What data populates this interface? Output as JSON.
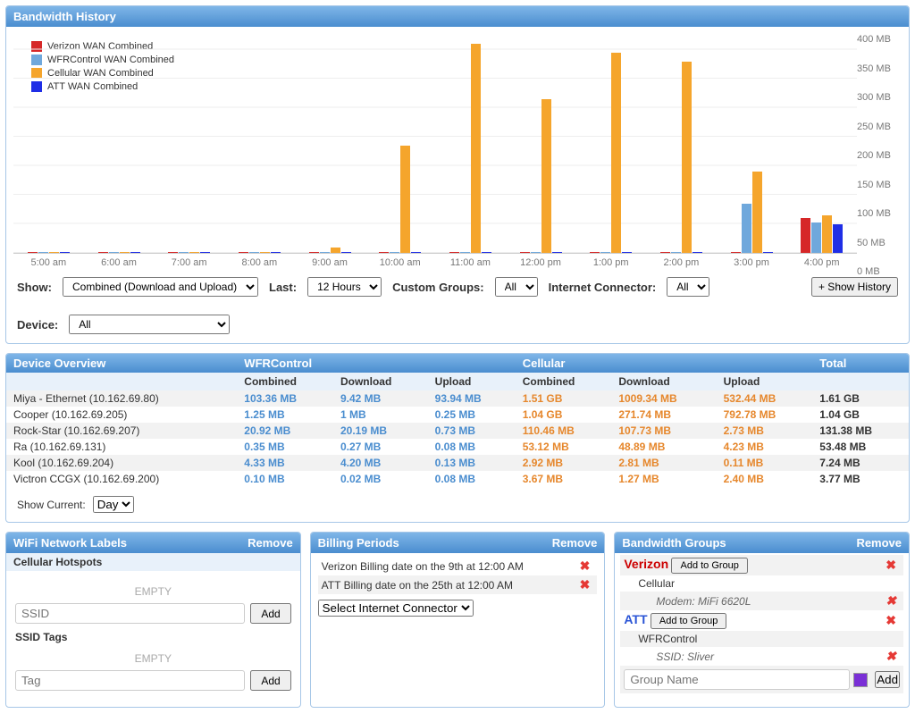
{
  "bandwidth_history": {
    "title": "Bandwidth History",
    "legend": [
      {
        "label": "Verizon WAN Combined",
        "color": "#d62728"
      },
      {
        "label": "WFRControl WAN Combined",
        "color": "#6fa8dc"
      },
      {
        "label": "Cellular WAN Combined",
        "color": "#f5a52c"
      },
      {
        "label": "ATT WAN Combined",
        "color": "#1f2ee6"
      }
    ],
    "controls": {
      "show_label": "Show:",
      "show_value": "Combined (Download and Upload)",
      "last_label": "Last:",
      "last_value": "12 Hours",
      "groups_label": "Custom Groups:",
      "groups_value": "All",
      "connector_label": "Internet Connector:",
      "connector_value": "All",
      "device_label": "Device:",
      "device_value": "All",
      "show_history": "+ Show History"
    }
  },
  "chart_data": {
    "type": "bar",
    "title": "Bandwidth History",
    "ylabel": "MB",
    "ylim": [
      0,
      400
    ],
    "categories": [
      "5:00 am",
      "6:00 am",
      "7:00 am",
      "8:00 am",
      "9:00 am",
      "10:00 am",
      "11:00 am",
      "12:00 pm",
      "1:00 pm",
      "2:00 pm",
      "3:00 pm",
      "4:00 pm"
    ],
    "y_ticks": [
      "400 MB",
      "350 MB",
      "300 MB",
      "250 MB",
      "200 MB",
      "150 MB",
      "100 MB",
      "50 MB",
      "0 MB"
    ],
    "series": [
      {
        "name": "Verizon WAN Combined",
        "color": "#d62728",
        "values": [
          0,
          0,
          0,
          0,
          0,
          0,
          0,
          0,
          0,
          0,
          0,
          60
        ]
      },
      {
        "name": "WFRControl WAN Combined",
        "color": "#6fa8dc",
        "values": [
          0,
          0,
          0,
          0,
          0,
          0,
          0,
          0,
          0,
          0,
          85,
          52
        ]
      },
      {
        "name": "Cellular WAN Combined",
        "color": "#f5a52c",
        "values": [
          2,
          2,
          1,
          2,
          10,
          185,
          360,
          265,
          345,
          330,
          140,
          65
        ]
      },
      {
        "name": "ATT WAN Combined",
        "color": "#1f2ee6",
        "values": [
          0,
          0,
          0,
          0,
          0,
          0,
          0,
          0,
          0,
          0,
          0,
          50
        ]
      }
    ]
  },
  "device_overview": {
    "title": "Device Overview",
    "group_wfr": "WFRControl",
    "group_cell": "Cellular",
    "group_total": "Total",
    "col_combined": "Combined",
    "col_download": "Download",
    "col_upload": "Upload",
    "rows": [
      {
        "name": "Miya - Ethernet (10.162.69.80)",
        "wfr_c": "103.36 MB",
        "wfr_d": "9.42 MB",
        "wfr_u": "93.94 MB",
        "cel_c": "1.51 GB",
        "cel_d": "1009.34 MB",
        "cel_u": "532.44 MB",
        "total": "1.61 GB"
      },
      {
        "name": "Cooper (10.162.69.205)",
        "wfr_c": "1.25 MB",
        "wfr_d": "1 MB",
        "wfr_u": "0.25 MB",
        "cel_c": "1.04 GB",
        "cel_d": "271.74 MB",
        "cel_u": "792.78 MB",
        "total": "1.04 GB"
      },
      {
        "name": "Rock-Star (10.162.69.207)",
        "wfr_c": "20.92 MB",
        "wfr_d": "20.19 MB",
        "wfr_u": "0.73 MB",
        "cel_c": "110.46 MB",
        "cel_d": "107.73 MB",
        "cel_u": "2.73 MB",
        "total": "131.38 MB"
      },
      {
        "name": "Ra (10.162.69.131)",
        "wfr_c": "0.35 MB",
        "wfr_d": "0.27 MB",
        "wfr_u": "0.08 MB",
        "cel_c": "53.12 MB",
        "cel_d": "48.89 MB",
        "cel_u": "4.23 MB",
        "total": "53.48 MB"
      },
      {
        "name": "Kool (10.162.69.204)",
        "wfr_c": "4.33 MB",
        "wfr_d": "4.20 MB",
        "wfr_u": "0.13 MB",
        "cel_c": "2.92 MB",
        "cel_d": "2.81 MB",
        "cel_u": "0.11 MB",
        "total": "7.24 MB"
      },
      {
        "name": "Victron CCGX (10.162.69.200)",
        "wfr_c": "0.10 MB",
        "wfr_d": "0.02 MB",
        "wfr_u": "0.08 MB",
        "cel_c": "3.67 MB",
        "cel_d": "1.27 MB",
        "cel_u": "2.40 MB",
        "total": "3.77 MB"
      }
    ],
    "show_current_label": "Show Current:",
    "show_current_value": "Day"
  },
  "wifi_labels": {
    "title": "WiFi Network Labels",
    "remove": "Remove",
    "hotspots_label": "Cellular Hotspots",
    "empty": "EMPTY",
    "ssid_placeholder": "SSID",
    "tags_label": "SSID Tags",
    "tag_placeholder": "Tag",
    "add": "Add"
  },
  "billing": {
    "title": "Billing Periods",
    "remove": "Remove",
    "rows": [
      "Verizon Billing date on the 9th at 12:00 AM",
      "ATT Billing date on the 25th at 12:00 AM"
    ],
    "select_label": "Select Internet Connector"
  },
  "bw_groups": {
    "title": "Bandwidth Groups",
    "remove": "Remove",
    "add_to_group": "Add to Group",
    "add": "Add",
    "group_placeholder": "Group Name",
    "verizon": {
      "name": "Verizon",
      "children": [
        {
          "name": "Cellular",
          "sub": "Modem: MiFi 6620L"
        }
      ]
    },
    "att": {
      "name": "ATT",
      "children": [
        {
          "name": "WFRControl",
          "sub": "SSID: Sliver"
        }
      ]
    }
  }
}
